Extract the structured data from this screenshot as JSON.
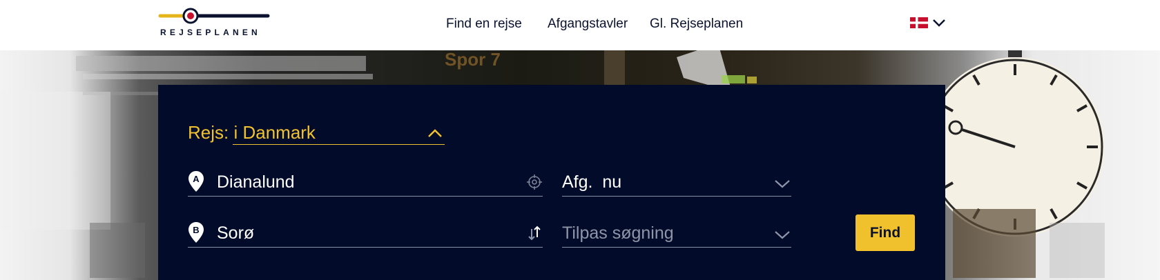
{
  "brand": {
    "name": "REJSEPLANEN"
  },
  "nav": {
    "items": [
      {
        "label": "Find en rejse"
      },
      {
        "label": "Afgangstavler"
      },
      {
        "label": "Gl. Rejseplanen"
      }
    ]
  },
  "language": {
    "icon": "danish-flag-icon"
  },
  "search": {
    "trip_type": "Rejs: i Danmark",
    "from": {
      "value": "Dianalund",
      "icon": "pin-a-icon"
    },
    "to": {
      "value": "Sorø",
      "icon": "pin-b-icon"
    },
    "departure": {
      "value": "Afg.  nu"
    },
    "advanced": {
      "placeholder": "Tilpas søgning"
    },
    "find_label": "Find"
  },
  "colors": {
    "accent": "#f2c12e",
    "panel": "#020c2a",
    "nav_text": "#0a1230",
    "brand_red": "#c8102e"
  },
  "hero": {
    "sign_text": "Spor 7"
  }
}
